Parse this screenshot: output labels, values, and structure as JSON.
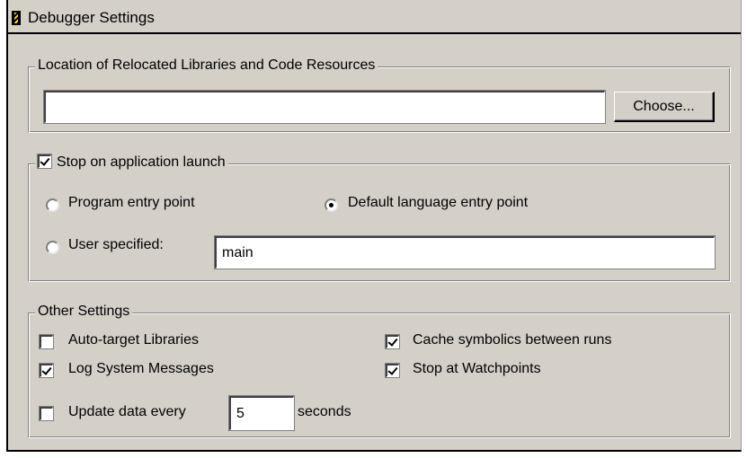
{
  "title": "Debugger Settings",
  "relocated": {
    "legend": "Location of Relocated Libraries and Code Resources",
    "path_value": "",
    "choose_label": "Choose..."
  },
  "launch": {
    "stop_label": "Stop on application launch",
    "stop_checked": true,
    "program_entry_label": "Program entry point",
    "default_entry_label": "Default language entry point",
    "user_specified_label": "User specified:",
    "user_specified_value": "main",
    "selected": "default_entry"
  },
  "other": {
    "legend": "Other Settings",
    "auto_target_label": "Auto-target Libraries",
    "auto_target_checked": false,
    "cache_symbolics_label": "Cache symbolics between runs",
    "cache_symbolics_checked": true,
    "log_messages_label": "Log System Messages",
    "log_messages_checked": true,
    "watchpoints_label": "Stop at Watchpoints",
    "watchpoints_checked": true,
    "update_label": "Update data every",
    "update_checked": false,
    "update_value": "5",
    "seconds_label": "seconds"
  }
}
